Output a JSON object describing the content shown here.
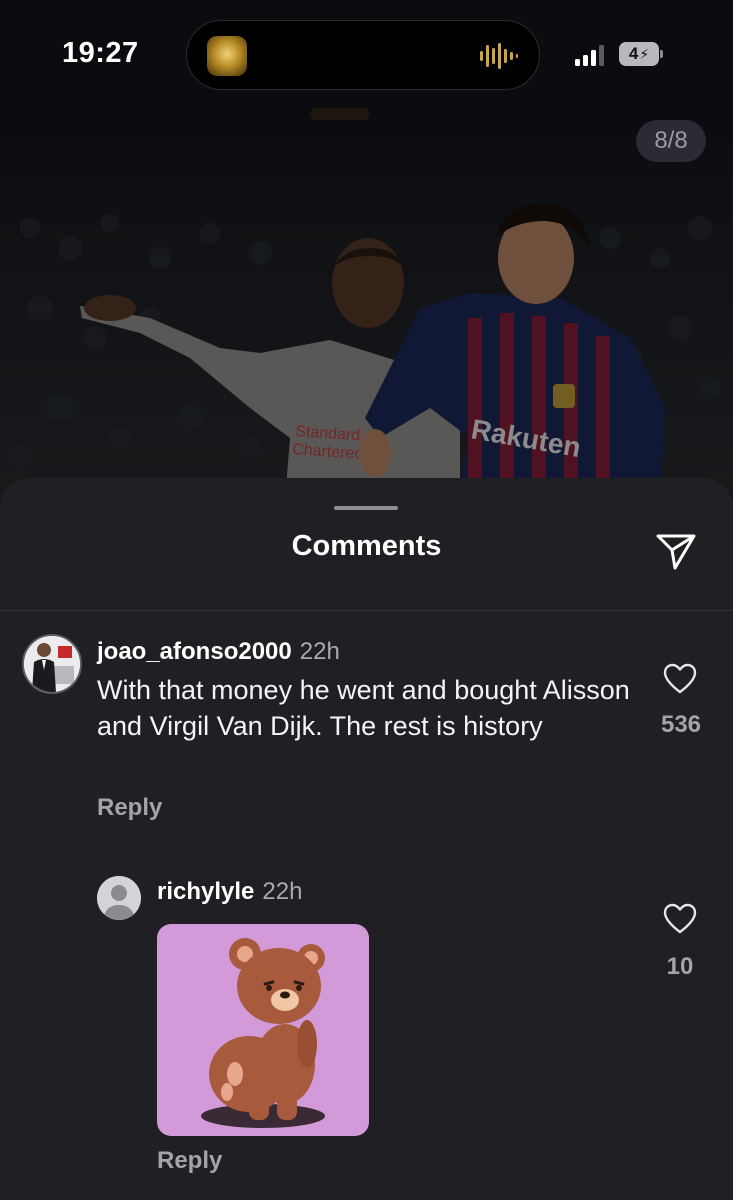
{
  "status_bar": {
    "time": "19:27",
    "battery": "4",
    "icons": [
      "app-activity-icon",
      "audio-wave-icon",
      "signal-icon",
      "battery-icon"
    ]
  },
  "post": {
    "page_counter": "8/8"
  },
  "sheet": {
    "title": "Comments",
    "share_icon": "paper-plane-icon"
  },
  "comments": [
    {
      "username": "joao_afonso2000",
      "time": "22h",
      "text": "With that money he went and bought Alisson and Virgil Van Dijk. The rest is history",
      "reply_label": "Reply",
      "like_count": "536"
    },
    {
      "username": "richylyle",
      "time": "22h",
      "content": "bear-sticker-image",
      "reply_label": "Reply",
      "like_count": "10"
    }
  ],
  "colors": {
    "background": "#1f1f24",
    "statusbar": "#0c0c10",
    "muted_text": "#a3a3aa",
    "sticker_bg": "#d29ad8"
  }
}
